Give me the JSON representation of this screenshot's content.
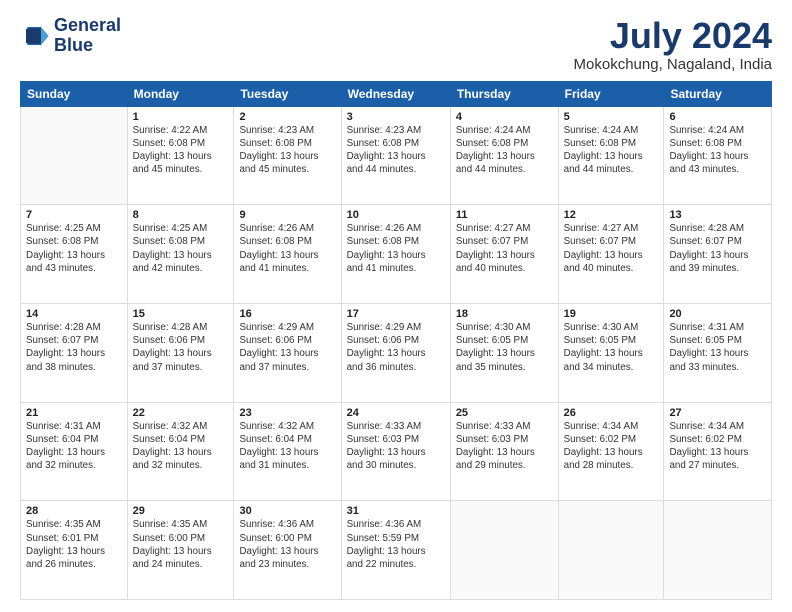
{
  "logo": {
    "line1": "General",
    "line2": "Blue"
  },
  "title": {
    "month_year": "July 2024",
    "location": "Mokokchung, Nagaland, India"
  },
  "days_of_week": [
    "Sunday",
    "Monday",
    "Tuesday",
    "Wednesday",
    "Thursday",
    "Friday",
    "Saturday"
  ],
  "weeks": [
    [
      {
        "day": "",
        "info": ""
      },
      {
        "day": "1",
        "info": "Sunrise: 4:22 AM\nSunset: 6:08 PM\nDaylight: 13 hours\nand 45 minutes."
      },
      {
        "day": "2",
        "info": "Sunrise: 4:23 AM\nSunset: 6:08 PM\nDaylight: 13 hours\nand 45 minutes."
      },
      {
        "day": "3",
        "info": "Sunrise: 4:23 AM\nSunset: 6:08 PM\nDaylight: 13 hours\nand 44 minutes."
      },
      {
        "day": "4",
        "info": "Sunrise: 4:24 AM\nSunset: 6:08 PM\nDaylight: 13 hours\nand 44 minutes."
      },
      {
        "day": "5",
        "info": "Sunrise: 4:24 AM\nSunset: 6:08 PM\nDaylight: 13 hours\nand 44 minutes."
      },
      {
        "day": "6",
        "info": "Sunrise: 4:24 AM\nSunset: 6:08 PM\nDaylight: 13 hours\nand 43 minutes."
      }
    ],
    [
      {
        "day": "7",
        "info": "Sunrise: 4:25 AM\nSunset: 6:08 PM\nDaylight: 13 hours\nand 43 minutes."
      },
      {
        "day": "8",
        "info": "Sunrise: 4:25 AM\nSunset: 6:08 PM\nDaylight: 13 hours\nand 42 minutes."
      },
      {
        "day": "9",
        "info": "Sunrise: 4:26 AM\nSunset: 6:08 PM\nDaylight: 13 hours\nand 41 minutes."
      },
      {
        "day": "10",
        "info": "Sunrise: 4:26 AM\nSunset: 6:08 PM\nDaylight: 13 hours\nand 41 minutes."
      },
      {
        "day": "11",
        "info": "Sunrise: 4:27 AM\nSunset: 6:07 PM\nDaylight: 13 hours\nand 40 minutes."
      },
      {
        "day": "12",
        "info": "Sunrise: 4:27 AM\nSunset: 6:07 PM\nDaylight: 13 hours\nand 40 minutes."
      },
      {
        "day": "13",
        "info": "Sunrise: 4:28 AM\nSunset: 6:07 PM\nDaylight: 13 hours\nand 39 minutes."
      }
    ],
    [
      {
        "day": "14",
        "info": "Sunrise: 4:28 AM\nSunset: 6:07 PM\nDaylight: 13 hours\nand 38 minutes."
      },
      {
        "day": "15",
        "info": "Sunrise: 4:28 AM\nSunset: 6:06 PM\nDaylight: 13 hours\nand 37 minutes."
      },
      {
        "day": "16",
        "info": "Sunrise: 4:29 AM\nSunset: 6:06 PM\nDaylight: 13 hours\nand 37 minutes."
      },
      {
        "day": "17",
        "info": "Sunrise: 4:29 AM\nSunset: 6:06 PM\nDaylight: 13 hours\nand 36 minutes."
      },
      {
        "day": "18",
        "info": "Sunrise: 4:30 AM\nSunset: 6:05 PM\nDaylight: 13 hours\nand 35 minutes."
      },
      {
        "day": "19",
        "info": "Sunrise: 4:30 AM\nSunset: 6:05 PM\nDaylight: 13 hours\nand 34 minutes."
      },
      {
        "day": "20",
        "info": "Sunrise: 4:31 AM\nSunset: 6:05 PM\nDaylight: 13 hours\nand 33 minutes."
      }
    ],
    [
      {
        "day": "21",
        "info": "Sunrise: 4:31 AM\nSunset: 6:04 PM\nDaylight: 13 hours\nand 32 minutes."
      },
      {
        "day": "22",
        "info": "Sunrise: 4:32 AM\nSunset: 6:04 PM\nDaylight: 13 hours\nand 32 minutes."
      },
      {
        "day": "23",
        "info": "Sunrise: 4:32 AM\nSunset: 6:04 PM\nDaylight: 13 hours\nand 31 minutes."
      },
      {
        "day": "24",
        "info": "Sunrise: 4:33 AM\nSunset: 6:03 PM\nDaylight: 13 hours\nand 30 minutes."
      },
      {
        "day": "25",
        "info": "Sunrise: 4:33 AM\nSunset: 6:03 PM\nDaylight: 13 hours\nand 29 minutes."
      },
      {
        "day": "26",
        "info": "Sunrise: 4:34 AM\nSunset: 6:02 PM\nDaylight: 13 hours\nand 28 minutes."
      },
      {
        "day": "27",
        "info": "Sunrise: 4:34 AM\nSunset: 6:02 PM\nDaylight: 13 hours\nand 27 minutes."
      }
    ],
    [
      {
        "day": "28",
        "info": "Sunrise: 4:35 AM\nSunset: 6:01 PM\nDaylight: 13 hours\nand 26 minutes."
      },
      {
        "day": "29",
        "info": "Sunrise: 4:35 AM\nSunset: 6:00 PM\nDaylight: 13 hours\nand 24 minutes."
      },
      {
        "day": "30",
        "info": "Sunrise: 4:36 AM\nSunset: 6:00 PM\nDaylight: 13 hours\nand 23 minutes."
      },
      {
        "day": "31",
        "info": "Sunrise: 4:36 AM\nSunset: 5:59 PM\nDaylight: 13 hours\nand 22 minutes."
      },
      {
        "day": "",
        "info": ""
      },
      {
        "day": "",
        "info": ""
      },
      {
        "day": "",
        "info": ""
      }
    ]
  ]
}
